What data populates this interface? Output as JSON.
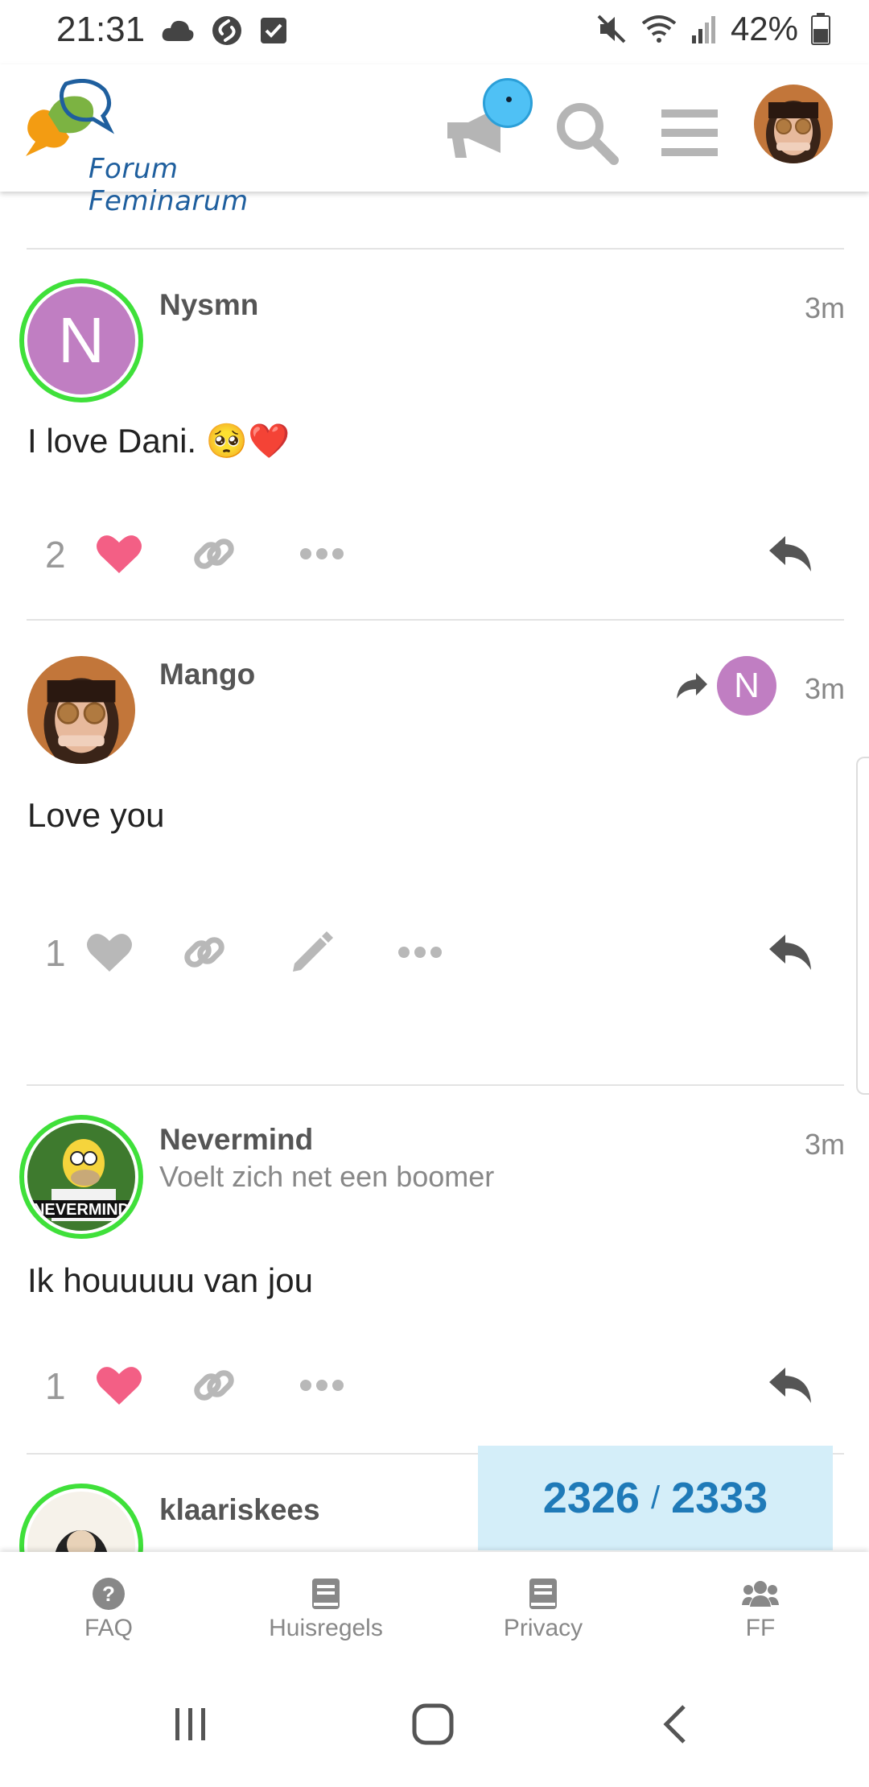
{
  "status_bar": {
    "time": "21:31",
    "battery_percent": "42%",
    "icons": [
      "cloud-icon",
      "shazam-icon",
      "checkbox-icon",
      "mute-icon",
      "wifi-icon",
      "signal-icon",
      "battery-icon"
    ]
  },
  "header": {
    "logo_text": "Forum Feminarum",
    "notification_dot_color": "#4fc1f5"
  },
  "posts": [
    {
      "username": "Nysmn",
      "avatar_letter": "N",
      "time": "3m",
      "body": "I love Dani. 🥺❤️",
      "like_count": "2",
      "liked": true
    },
    {
      "username": "Mango",
      "time": "3m",
      "body": "Love you",
      "reply_to_letter": "N",
      "like_count": "1",
      "liked": false
    },
    {
      "username": "Nevermind",
      "user_title": "Voelt zich net een boomer",
      "time": "3m",
      "body": "Ik houuuuu van jou",
      "like_count": "1",
      "liked": true
    },
    {
      "username": "klaariskees"
    }
  ],
  "progress": {
    "current": "2326",
    "separator": "/",
    "total": "2333"
  },
  "footer": {
    "items": [
      {
        "label": "FAQ",
        "icon": "question-circle-icon"
      },
      {
        "label": "Huisregels",
        "icon": "book-icon"
      },
      {
        "label": "Privacy",
        "icon": "book-icon"
      },
      {
        "label": "FF",
        "icon": "users-icon"
      }
    ]
  },
  "colors": {
    "like_active": "#f35f85",
    "icon_gray": "#b8b8b8",
    "avatar_ring": "#3fe03a",
    "letter_avatar": "#c07ec2",
    "progress_bg": "#d4eef9",
    "progress_text": "#1f7ab8"
  }
}
